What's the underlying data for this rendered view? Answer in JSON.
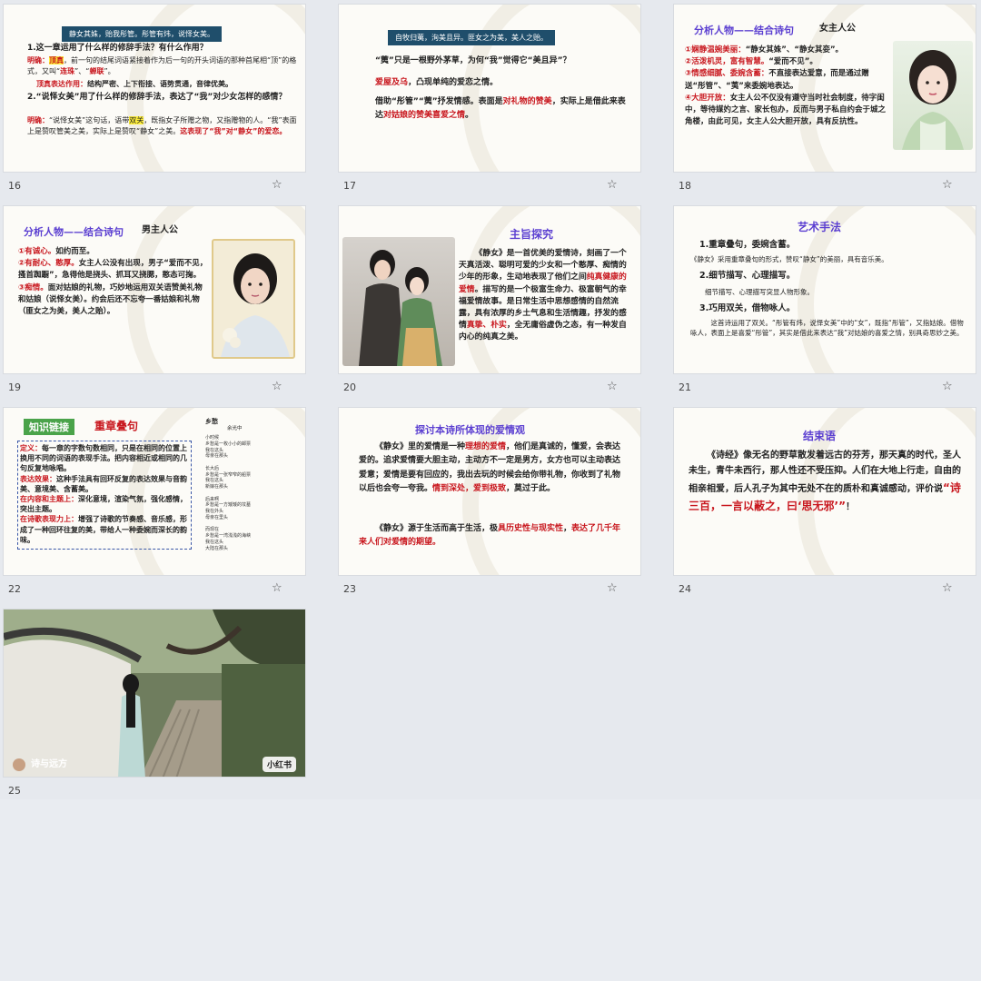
{
  "slides": [
    {
      "number": "16",
      "banner": "静女其姝，贻我彤管。彤管有炜，说怿女美。",
      "q1": "1.这一章运用了什么样的修辞手法？有什么作用？",
      "a1_label": "明确：",
      "a1_hl": "顶真",
      "a1_text1": "，前一句的结尾词语紧接着作为后一句的开头词语的那种首尾相“顶”的格式，又叫“",
      "a1_red1": "连珠",
      "a1_mid": "”、“",
      "a1_red2": "蝉联",
      "a1_end": "”。",
      "effect_red": "顶真表达作用：",
      "effect_text": "结构严密、上下衔接、语势贯通，音律优美。",
      "q2": "2.“说怿女美”用了什么样的修辞手法，表达了“我”对少女怎样的感情？",
      "a2_label": "明确：",
      "a2_text1": "“说怿女美”这句话，语带",
      "a2_hl": "双关",
      "a2_text2": "，既指女子所赠之物，又指赠物的人。“我”表面上是赞叹管美之美，实际上是赞叹“静女”之美。",
      "a2_red": "这表现了“我”对“静女”的爱恋。"
    },
    {
      "number": "17",
      "banner": "自牧归荑，洵美且异。匪女之为美，美人之贻。",
      "q": "“荑”只是一根野外茅草，为何“我”觉得它“美且异”？",
      "p1_red": "爱屋及乌",
      "p1_text": "，凸现单纯的爱恋之情。",
      "p2_text1": "借助“彤管”“荑”抒发情感。表面是",
      "p2_red1": "对礼物的赞美",
      "p2_text2": "，实际上是借此来表达",
      "p2_red2": "对姑娘的赞美喜爱之情",
      "p2_end": "。"
    },
    {
      "number": "18",
      "title": "分析人物——结合诗句",
      "subtitle": "女主人公",
      "items": [
        {
          "red": "①娴静温婉美丽：",
          "text": "“静女其姝”、“静女其娈”。"
        },
        {
          "red": "②活泼机灵，富有智慧。",
          "text": "“爱而不见”。"
        },
        {
          "red": "③情感细腻、委婉含蓄：",
          "text": "不直接表达爱意，而是通过赠送“彤管”、“荑”来委婉地表达。"
        },
        {
          "red": "④大胆开放：",
          "text": "女主人公不仅没有遵守当时社会制度，待字闺中，等待媒妁之言、家长包办，反而与男子私自约会于城之角楼，由此可见，女主人公大胆开放，具有反抗性。"
        }
      ]
    },
    {
      "number": "19",
      "title": "分析人物——结合诗句",
      "subtitle": "男主人公",
      "items": [
        {
          "red": "①有诚心。",
          "text": "如约而至。"
        },
        {
          "red": "②有耐心、憨厚。",
          "text": "女主人公没有出现，男子“爱而不见，搔首踟蹰”，急得他是挠头、抓耳又挠腮，憨态可掬。"
        },
        {
          "red": "③痴情。",
          "text": "面对姑娘的礼物，巧妙地运用双关语赞美礼物和姑娘（说怿女美）。约会后还不忘夸一番姑娘和礼物（匪女之为美，美人之贻）。"
        }
      ]
    },
    {
      "number": "20",
      "title": "主旨探究",
      "p_text1": "《静女》是一首优美的爱情诗，刻画了一个天真活泼、聪明可爱的少女和一个憨厚、痴情的少年的形象，生动地表现了他们之间",
      "p_red1": "纯真健康的爱情",
      "p_text2": "。描写的是一个极富生命力、极富朝气的幸福爱情故事。是日常生活中思想感情的自然流露，具有浓厚的乡土气息和生活情趣，抒发的感情",
      "p_red2": "真挚、朴实",
      "p_text3": "，全无庸俗虚伪之态，有一种发自内心的纯真之美。"
    },
    {
      "number": "21",
      "title": "艺术手法",
      "h1": "1.重章叠句，委婉含蓄。",
      "d1": "《静女》采用重章叠句的形式，赞叹“静女”的美丽，具有音乐美。",
      "h2": "2.细节描写、心理描写。",
      "d2": "细节描写、心理描写突显人物形象。",
      "h3": "3.巧用双关，借物咏人。",
      "d3": "这首诗运用了双关。“彤管有炜，说怿女美”中的“女”，既指“彤管”，又指姑娘。借物咏人，表面上是喜爱“彤管”，其实是借此来表达“我”对姑娘的喜爱之情，别具奇思妙之美。"
    },
    {
      "number": "22",
      "tag": "知识链接",
      "title": "重章叠句",
      "def_red": "定义：",
      "def": "每一章的字数句数相同，只是在相同的位置上换用不同的词语的表现手法。把内容相近或相同的几句反复地咏唱。",
      "eff_red": "表达效果：",
      "eff": "这种手法具有回环反复的表达效果与音韵美、意境美、含蓄美。",
      "c_red": "在内容和主题上：",
      "c": "深化意境，渲染气氛，强化感情，突出主题。",
      "f_red": "在诗歌表现力上：",
      "f": "增强了诗歌的节奏感、音乐感，形成了一种回环往复的美，带给人一种委婉而深长的韵味。",
      "poem_title": "乡愁",
      "poem_author": "余光中",
      "poem_lines": [
        "小时候",
        "乡愁是一枚小小的邮票",
        "我在这头",
        "母亲在那头",
        "",
        "长大后",
        "乡愁是一张窄窄的船票",
        "我在这头",
        "新娘在那头",
        "",
        "后来啊",
        "乡愁是一方矮矮的坟墓",
        "我在外头",
        "母亲在里头",
        "",
        "而现在",
        "乡愁是一湾浅浅的海峡",
        "我在这头",
        "大陆在那头"
      ]
    },
    {
      "number": "23",
      "title": "探讨本诗所体现的爱情观",
      "p1_text1": "《静女》里的爱情是一种",
      "p1_red1": "理想的爱情",
      "p1_text2": "，他们是真诚的，懂爱，会表达爱的。追求爱情要大胆主动，主动方不一定是男方，女方也可以主动表达爱意；爱情是要有回应的，我出去玩的时候会给你带礼物，你收到了礼物以后也会夸一夸我。",
      "p1_red2": "情到深处，爱到极致",
      "p1_end": "，莫过于此。",
      "p2_text1": "《静女》源于生活而高于生活，极",
      "p2_red1": "具历史性与现实性",
      "p2_text2": "，",
      "p2_red2": "表达了几千年来人们对爱情的期望。"
    },
    {
      "number": "24",
      "title": "结束语",
      "p_text": "《诗经》像无名的野草散发着远古的芬芳，那天真的时代，圣人未生，青牛未西行，那人性还不受压抑。人们在大地上行走，自由的相亲相爱，后人孔子为其中无处不在的质朴和真诚感动，评价说",
      "p_red": "“诗三百，一言以蔽之，曰‘思无邪’”",
      "p_end": "！"
    },
    {
      "number": "25",
      "user": "诗与远方",
      "brand": "小红书"
    }
  ],
  "ui": {
    "star_icon": "☆"
  },
  "colors": {
    "accent_red": "#c8161d",
    "title_purple": "#5b3fd1",
    "banner_blue": "#1f4e6b"
  }
}
